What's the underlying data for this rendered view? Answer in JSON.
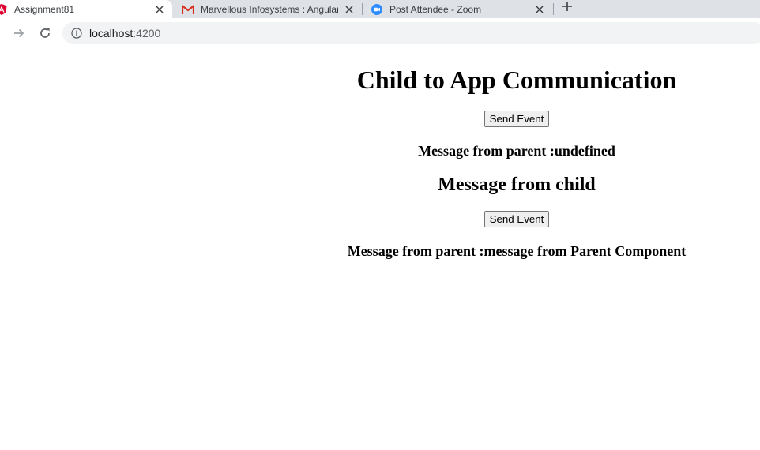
{
  "tabs": [
    {
      "title": "Assignment81",
      "favicon": "angular-icon",
      "active": true
    },
    {
      "title": "Marvellous Infosystems : Angular",
      "favicon": "gmail-icon",
      "active": false
    },
    {
      "title": "Post Attendee - Zoom",
      "favicon": "zoom-icon",
      "active": false
    }
  ],
  "address_bar": {
    "host": "localhost",
    "port": ":4200"
  },
  "app": {
    "title": "Child to App Communication",
    "send_button": "Send Event",
    "parent_message": "Message from parent :undefined"
  },
  "child": {
    "title": "Message from child",
    "send_button": "Send Event",
    "parent_message": "Message from parent :message from Parent Component"
  },
  "colors": {
    "tabstrip": "#dee1e6",
    "angular_red": "#dd0031",
    "gmail_red": "#d93025",
    "zoom_blue": "#2d8cff"
  }
}
